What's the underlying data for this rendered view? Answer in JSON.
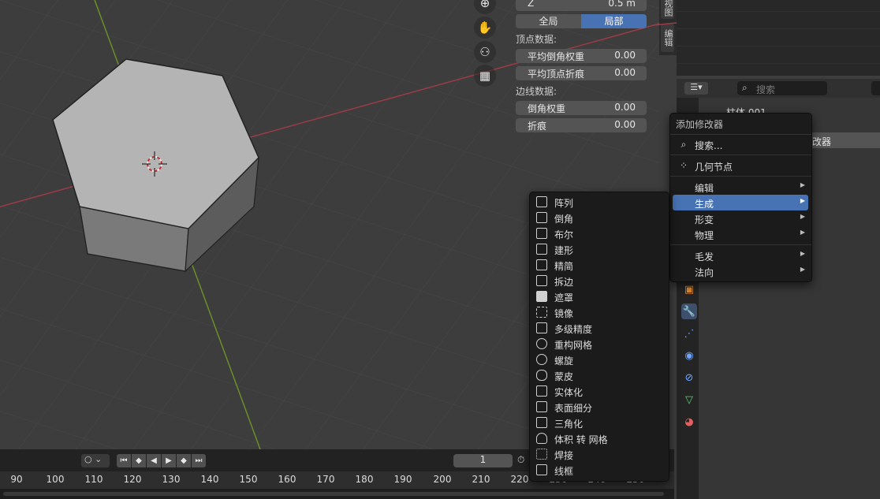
{
  "npanel": {
    "z_label": "Z",
    "z_value": "0.5 m",
    "global_label": "全局",
    "local_label": "局部",
    "vertex_data_label": "顶点数据:",
    "mean_vertex_bevel_label": "平均倒角权重",
    "mean_vertex_bevel_value": "0.00",
    "mean_vertex_crease_label": "平均顶点折痕",
    "mean_vertex_crease_value": "0.00",
    "edge_data_label": "边线数据:",
    "edge_bevel_label": "倒角权重",
    "edge_bevel_value": "0.00",
    "edge_crease_label": "折痕",
    "edge_crease_value": "0.00"
  },
  "vtabs": {
    "view_tab": "视图",
    "tool_tab": "编辑"
  },
  "properties": {
    "search_placeholder": "搜索",
    "object_name_partial": "柱体.001",
    "modifier_partial": "改器",
    "accent_color": "#4772b3"
  },
  "add_modifier_menu": {
    "title": "添加修改器",
    "search": "搜索...",
    "geometry_nodes": "几何节点",
    "categories": [
      "编辑",
      "生成",
      "形变",
      "物理"
    ],
    "categories2": [
      "毛发",
      "法向"
    ],
    "highlighted": "生成"
  },
  "generate_menu": {
    "items": [
      "阵列",
      "倒角",
      "布尔",
      "建形",
      "精简",
      "拆边",
      "遮罩",
      "镜像",
      "多级精度",
      "重构网格",
      "螺旋",
      "蒙皮",
      "实体化",
      "表面细分",
      "三角化",
      "体积 转 网格",
      "焊接",
      "线框"
    ]
  },
  "timeline": {
    "current_frame": "1",
    "ticks": [
      "90",
      "100",
      "110",
      "120",
      "130",
      "140",
      "150",
      "160",
      "170",
      "180",
      "190",
      "200",
      "210",
      "220",
      "230",
      "240",
      "250"
    ]
  }
}
